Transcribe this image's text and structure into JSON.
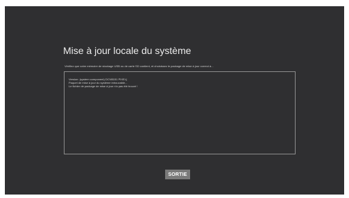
{
  "dialog": {
    "title": "Mise à jour locale du système",
    "instruction": "Vérifiez que votre mémoire de stockage USB ou de carte SD contient, et choisissez le package de mise à jour correct à...",
    "log_lines": [
      "Version: (system component) DCN5151 PIXEL)",
      "Paquet de mise à jour du système introuvable...",
      "Le fichier de package de mise à jour n'a pas été trouvé !"
    ],
    "exit_label": "SORTIE"
  },
  "colors": {
    "background": "#2f2f31",
    "button": "#7a7a7a",
    "border": "#8c8c8c",
    "text": "#e9e9e9"
  }
}
